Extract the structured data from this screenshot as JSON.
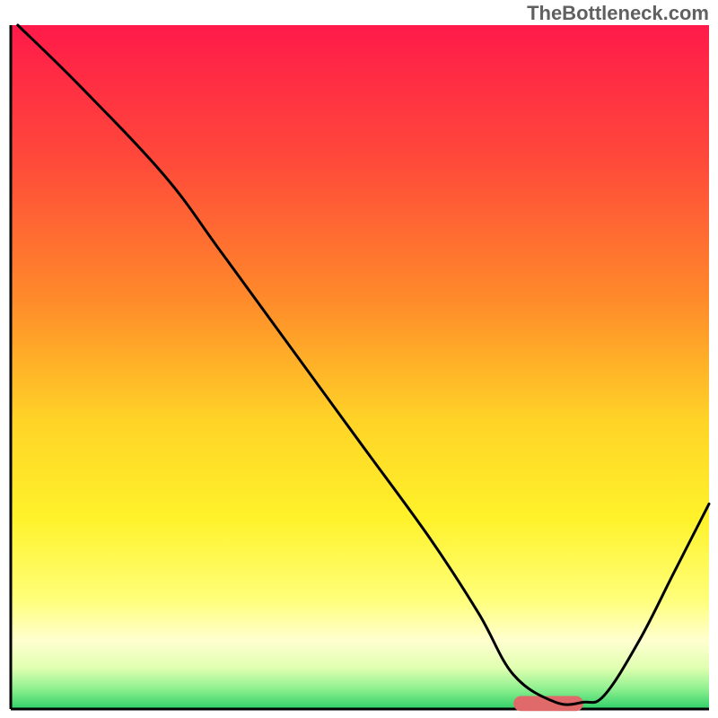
{
  "watermark": "TheBottleneck.com",
  "chart_data": {
    "type": "line",
    "title": "",
    "xlabel": "",
    "ylabel": "",
    "x_range": [
      0,
      100
    ],
    "y_range": [
      0,
      100
    ],
    "background_gradient": {
      "stops": [
        {
          "offset": 0.0,
          "color": "#ff1a4a"
        },
        {
          "offset": 0.2,
          "color": "#ff4a3a"
        },
        {
          "offset": 0.4,
          "color": "#ff8a2a"
        },
        {
          "offset": 0.58,
          "color": "#ffd427"
        },
        {
          "offset": 0.72,
          "color": "#fff22a"
        },
        {
          "offset": 0.84,
          "color": "#ffff7a"
        },
        {
          "offset": 0.9,
          "color": "#ffffd0"
        },
        {
          "offset": 0.94,
          "color": "#e0ffb0"
        },
        {
          "offset": 0.97,
          "color": "#90f090"
        },
        {
          "offset": 1.0,
          "color": "#2fd068"
        }
      ]
    },
    "series": [
      {
        "name": "bottleneck-curve",
        "color": "#000000",
        "stroke_width": 3,
        "x": [
          1,
          10,
          22,
          30,
          40,
          50,
          60,
          67,
          72,
          78,
          82,
          85,
          90,
          95,
          100
        ],
        "y": [
          100,
          91,
          78,
          67,
          53,
          39,
          25,
          14,
          5,
          1,
          1,
          2,
          10,
          20,
          30
        ]
      }
    ],
    "marker": {
      "name": "highlight-pill",
      "color": "#e06a6a",
      "x_center": 77,
      "y_center": 0.8,
      "width": 10,
      "height": 2.2
    },
    "baseline": {
      "color": "#000000",
      "stroke_width": 3,
      "y": 0
    },
    "left_border": {
      "color": "#000000",
      "stroke_width": 3,
      "x": 0
    }
  }
}
